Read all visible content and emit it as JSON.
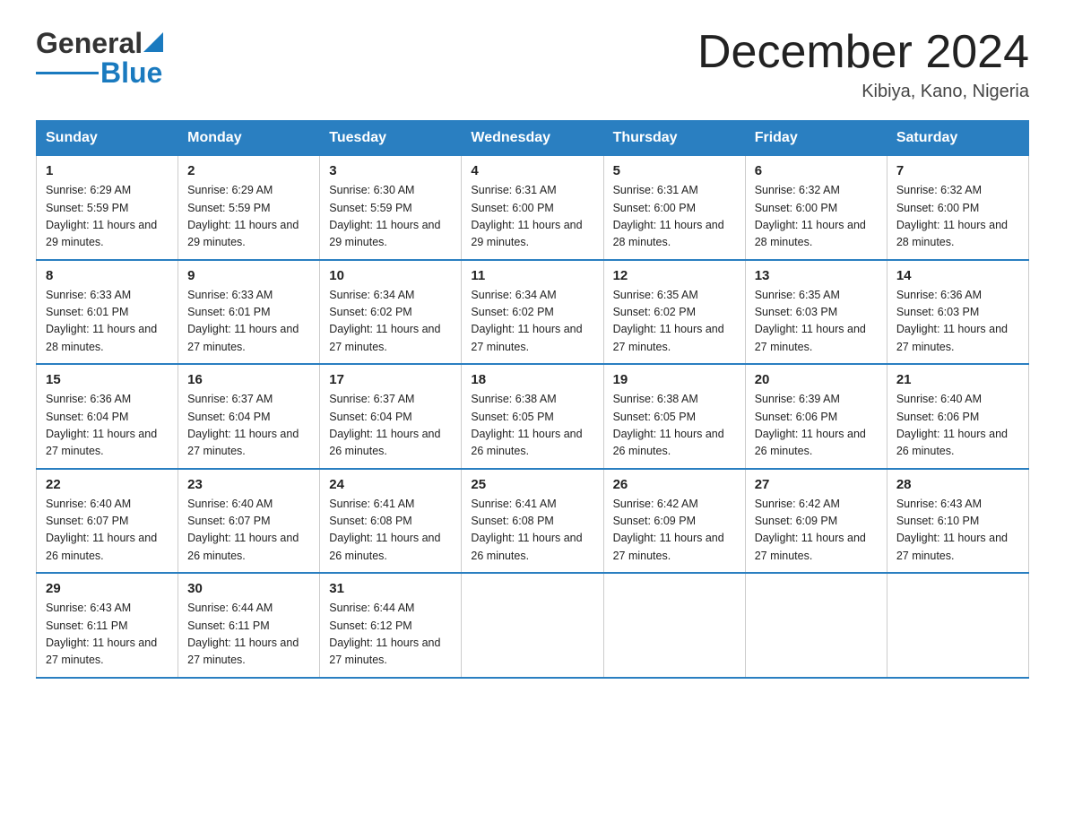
{
  "header": {
    "logo_general": "General",
    "logo_blue": "Blue",
    "month_title": "December 2024",
    "location": "Kibiya, Kano, Nigeria"
  },
  "days_of_week": [
    "Sunday",
    "Monday",
    "Tuesday",
    "Wednesday",
    "Thursday",
    "Friday",
    "Saturday"
  ],
  "weeks": [
    [
      {
        "day": "1",
        "sunrise": "6:29 AM",
        "sunset": "5:59 PM",
        "daylight": "11 hours and 29 minutes."
      },
      {
        "day": "2",
        "sunrise": "6:29 AM",
        "sunset": "5:59 PM",
        "daylight": "11 hours and 29 minutes."
      },
      {
        "day": "3",
        "sunrise": "6:30 AM",
        "sunset": "5:59 PM",
        "daylight": "11 hours and 29 minutes."
      },
      {
        "day": "4",
        "sunrise": "6:31 AM",
        "sunset": "6:00 PM",
        "daylight": "11 hours and 29 minutes."
      },
      {
        "day": "5",
        "sunrise": "6:31 AM",
        "sunset": "6:00 PM",
        "daylight": "11 hours and 28 minutes."
      },
      {
        "day": "6",
        "sunrise": "6:32 AM",
        "sunset": "6:00 PM",
        "daylight": "11 hours and 28 minutes."
      },
      {
        "day": "7",
        "sunrise": "6:32 AM",
        "sunset": "6:00 PM",
        "daylight": "11 hours and 28 minutes."
      }
    ],
    [
      {
        "day": "8",
        "sunrise": "6:33 AM",
        "sunset": "6:01 PM",
        "daylight": "11 hours and 28 minutes."
      },
      {
        "day": "9",
        "sunrise": "6:33 AM",
        "sunset": "6:01 PM",
        "daylight": "11 hours and 27 minutes."
      },
      {
        "day": "10",
        "sunrise": "6:34 AM",
        "sunset": "6:02 PM",
        "daylight": "11 hours and 27 minutes."
      },
      {
        "day": "11",
        "sunrise": "6:34 AM",
        "sunset": "6:02 PM",
        "daylight": "11 hours and 27 minutes."
      },
      {
        "day": "12",
        "sunrise": "6:35 AM",
        "sunset": "6:02 PM",
        "daylight": "11 hours and 27 minutes."
      },
      {
        "day": "13",
        "sunrise": "6:35 AM",
        "sunset": "6:03 PM",
        "daylight": "11 hours and 27 minutes."
      },
      {
        "day": "14",
        "sunrise": "6:36 AM",
        "sunset": "6:03 PM",
        "daylight": "11 hours and 27 minutes."
      }
    ],
    [
      {
        "day": "15",
        "sunrise": "6:36 AM",
        "sunset": "6:04 PM",
        "daylight": "11 hours and 27 minutes."
      },
      {
        "day": "16",
        "sunrise": "6:37 AM",
        "sunset": "6:04 PM",
        "daylight": "11 hours and 27 minutes."
      },
      {
        "day": "17",
        "sunrise": "6:37 AM",
        "sunset": "6:04 PM",
        "daylight": "11 hours and 26 minutes."
      },
      {
        "day": "18",
        "sunrise": "6:38 AM",
        "sunset": "6:05 PM",
        "daylight": "11 hours and 26 minutes."
      },
      {
        "day": "19",
        "sunrise": "6:38 AM",
        "sunset": "6:05 PM",
        "daylight": "11 hours and 26 minutes."
      },
      {
        "day": "20",
        "sunrise": "6:39 AM",
        "sunset": "6:06 PM",
        "daylight": "11 hours and 26 minutes."
      },
      {
        "day": "21",
        "sunrise": "6:40 AM",
        "sunset": "6:06 PM",
        "daylight": "11 hours and 26 minutes."
      }
    ],
    [
      {
        "day": "22",
        "sunrise": "6:40 AM",
        "sunset": "6:07 PM",
        "daylight": "11 hours and 26 minutes."
      },
      {
        "day": "23",
        "sunrise": "6:40 AM",
        "sunset": "6:07 PM",
        "daylight": "11 hours and 26 minutes."
      },
      {
        "day": "24",
        "sunrise": "6:41 AM",
        "sunset": "6:08 PM",
        "daylight": "11 hours and 26 minutes."
      },
      {
        "day": "25",
        "sunrise": "6:41 AM",
        "sunset": "6:08 PM",
        "daylight": "11 hours and 26 minutes."
      },
      {
        "day": "26",
        "sunrise": "6:42 AM",
        "sunset": "6:09 PM",
        "daylight": "11 hours and 27 minutes."
      },
      {
        "day": "27",
        "sunrise": "6:42 AM",
        "sunset": "6:09 PM",
        "daylight": "11 hours and 27 minutes."
      },
      {
        "day": "28",
        "sunrise": "6:43 AM",
        "sunset": "6:10 PM",
        "daylight": "11 hours and 27 minutes."
      }
    ],
    [
      {
        "day": "29",
        "sunrise": "6:43 AM",
        "sunset": "6:11 PM",
        "daylight": "11 hours and 27 minutes."
      },
      {
        "day": "30",
        "sunrise": "6:44 AM",
        "sunset": "6:11 PM",
        "daylight": "11 hours and 27 minutes."
      },
      {
        "day": "31",
        "sunrise": "6:44 AM",
        "sunset": "6:12 PM",
        "daylight": "11 hours and 27 minutes."
      },
      null,
      null,
      null,
      null
    ]
  ]
}
